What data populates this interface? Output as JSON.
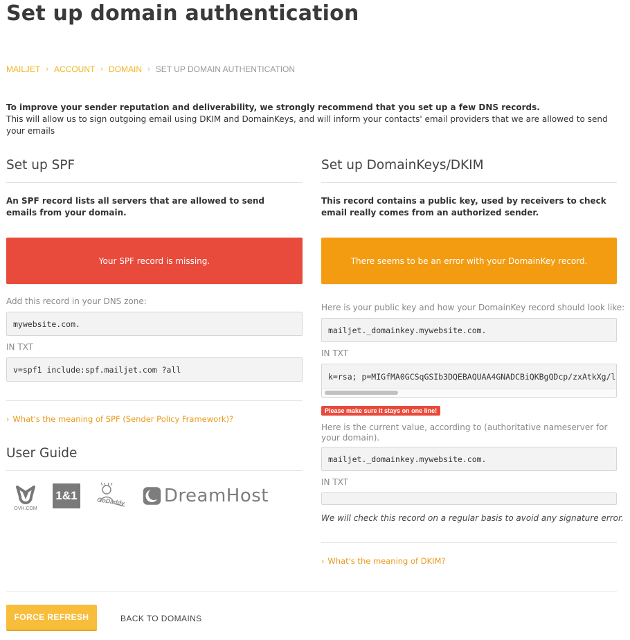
{
  "page": {
    "title": "Set up domain authentication"
  },
  "breadcrumb": {
    "items": [
      "MAILJET",
      "ACCOUNT",
      "DOMAIN"
    ],
    "current": "SET UP DOMAIN AUTHENTICATION"
  },
  "intro": {
    "bold": "To improve your sender reputation and deliverability, we strongly recommend that you set up a few DNS records.",
    "text": "This will allow us to sign outgoing email using DKIM and DomainKeys, and will inform your contacts' email providers that we are allowed to send your emails"
  },
  "spf": {
    "title": "Set up SPF",
    "lead": "An SPF record lists all servers that are allowed to send emails from your domain.",
    "alert": "Your SPF record is missing.",
    "add_label": "Add this record in your DNS zone:",
    "host": "mywebsite.com.",
    "type_label": "IN TXT",
    "value": "v=spf1 include:spf.mailjet.com ?all",
    "faq_link": "What's the meaning of SPF (Sender Policy Framework)?"
  },
  "user_guide": {
    "title": "User Guide",
    "logos": [
      {
        "name": "ovh-logo",
        "label": "OVH.COM"
      },
      {
        "name": "1and1-logo",
        "label": "1&1"
      },
      {
        "name": "godaddy-logo",
        "label": "GoDaddy"
      },
      {
        "name": "dreamhost-logo",
        "label": "DreamHost"
      }
    ]
  },
  "dkim": {
    "title": "Set up DomainKeys/DKIM",
    "lead": "This record contains a public key, used by receivers to check email really comes from an authorized sender.",
    "alert": "There seems to be an error with your DomainKey record.",
    "public_key_label": "Here is your public key and how your DomainKey record should look like:",
    "host": "mailjet._domainkey.mywebsite.com.",
    "type_label": "IN TXT",
    "value": "k=rsa; p=MIGfMA0GCSqGSIb3DQEBAQUAA4GNADCBiQKBgQDcp/zxAtkXg/l",
    "one_line_warning": "Please make sure it stays on one line!",
    "current_label": "Here is the current value, according to (authoritative nameserver for your domain).",
    "current_host": "mailjet._domainkey.mywebsite.com.",
    "current_type_label": "IN TXT",
    "current_value": "",
    "note": "We will check this record on a regular basis to avoid any signature error.",
    "faq_link": "What's the meaning of DKIM?"
  },
  "footer": {
    "refresh_button": "FORCE REFRESH",
    "back_link": "BACK TO DOMAINS"
  },
  "colors": {
    "accent": "#f3b521",
    "error": "#e84b3c",
    "warning": "#f39c11",
    "link": "#e89a1b"
  }
}
